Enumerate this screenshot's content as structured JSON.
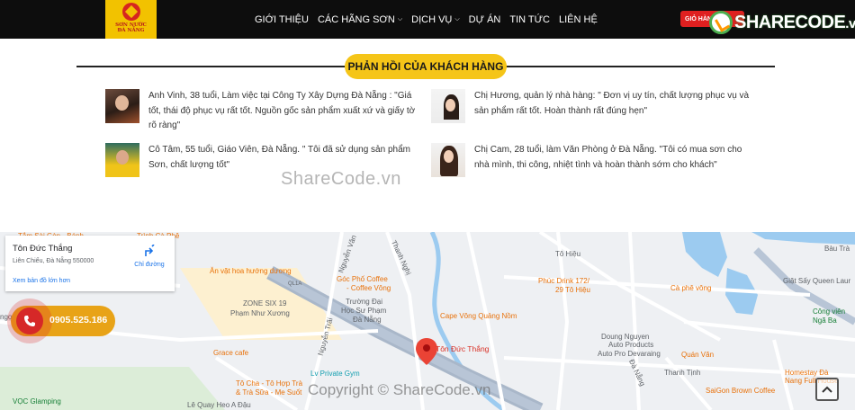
{
  "header": {
    "logo_line1": "SƠN NƯỚC",
    "logo_line2": "ĐÀ NẴNG",
    "nav": [
      {
        "label": "GIỚI THIỆU",
        "has_dropdown": false
      },
      {
        "label": "CÁC HÃNG SƠN",
        "has_dropdown": true
      },
      {
        "label": "DỊCH VỤ",
        "has_dropdown": true
      },
      {
        "label": "DỰ ÁN",
        "has_dropdown": false
      },
      {
        "label": "TIN TỨC",
        "has_dropdown": false
      },
      {
        "label": "LIÊN HỆ",
        "has_dropdown": false
      }
    ],
    "cart_label": "GIỎ HÀNG",
    "watermark_brand": "SHARECODE",
    "watermark_tld": ".vn"
  },
  "section": {
    "title": "PHẢN HỒI CỦA KHÁCH HÀNG"
  },
  "testimonials": [
    {
      "text": "Anh Vinh, 38 tuổi, Làm việc tại Công Ty Xây Dựng Đà Nẵng : \"Giá tốt, thái độ phục vụ rất tốt. Nguồn gốc sản phẩm xuất xứ và giấy tờ rõ ràng\""
    },
    {
      "text": "Chị Hương, quản lý nhà hàng: \" Đơn vị uy tín, chất lượng phục vụ và sản phẩm rất tốt. Hoàn thành rất đúng hẹn\""
    },
    {
      "text": "Cô Tâm, 55 tuổi, Giáo Viên, Đà Nẵng. \" Tôi đã sử dụng sản phẩm Sơn, chất lượng tốt\""
    },
    {
      "text": "Chị Cam, 28 tuổi, làm Văn Phòng ở Đà Nẵng. \"Tôi có mua sơn cho nhà mình, thi công, nhiệt tình và hoàn thành sớm cho khách\""
    }
  ],
  "watermark_mid": "ShareCode.vn",
  "map": {
    "card_title": "Tôn Đức Thắng",
    "card_address": "Liên Chiểu, Đà Nẵng 550000",
    "card_link": "Xem bản đồ lớn hơn",
    "directions_label": "Chỉ đường",
    "pin_label": "Tôn Đức Thắng",
    "labels": {
      "l1": "Tắm Sài Gòn - Bánh",
      "l2": "Trình Cà Phê",
      "l3": "Ăn vặt hoa hướng dương",
      "l4": "Góc Phố Coffee",
      "l5": "- Coffee Vông",
      "l6": "Trường Đại",
      "l7": "Học Sư Phạm",
      "l8": "Đà Nẵng",
      "l9": "ZONE SIX 19",
      "l10": "Phạm Như Xương",
      "l11": "Grace cafe",
      "l12": "Cape Vông Quảng Nồm",
      "l13": "Tô Hiệu",
      "l14": "Phúc Drink 172/",
      "l15": "29 Tô Hiệu",
      "l16": "Cà phê vông",
      "l17": "Doung Nguyen",
      "l18": "Auto Products",
      "l19": "Auto Pro Devaraing",
      "l20": "Quán Văn",
      "l21": "Giặt Sấy Queen Laur",
      "l22": "Công viên",
      "l23": "Ngã Ba",
      "l24": "Homestay Đà",
      "l25": "Nang Full House",
      "l26": "SaiGon Brown Coffee",
      "l27": "Tô Cha - Tô Hợp Trà",
      "l28": "& Trà Sữa - Me Suốt",
      "l29": "Lv Private Gym",
      "l30": "Lê Quay Heo A Đậu",
      "l31": "VỌC Glamping",
      "l32": "Thanh Nghị",
      "l33": "Nguyễn Văn",
      "l34": "Nguyễn Trãi",
      "l35": "Thanh Tịnh",
      "l36": "Đà Nẵng",
      "l37": "QL1A",
      "l38": "Bàu Trà",
      "l39": "ngọc Thạch"
    }
  },
  "hotline": {
    "number": "0905.525.186"
  },
  "watermark_bottom": "Copyright © ShareCode.vn"
}
